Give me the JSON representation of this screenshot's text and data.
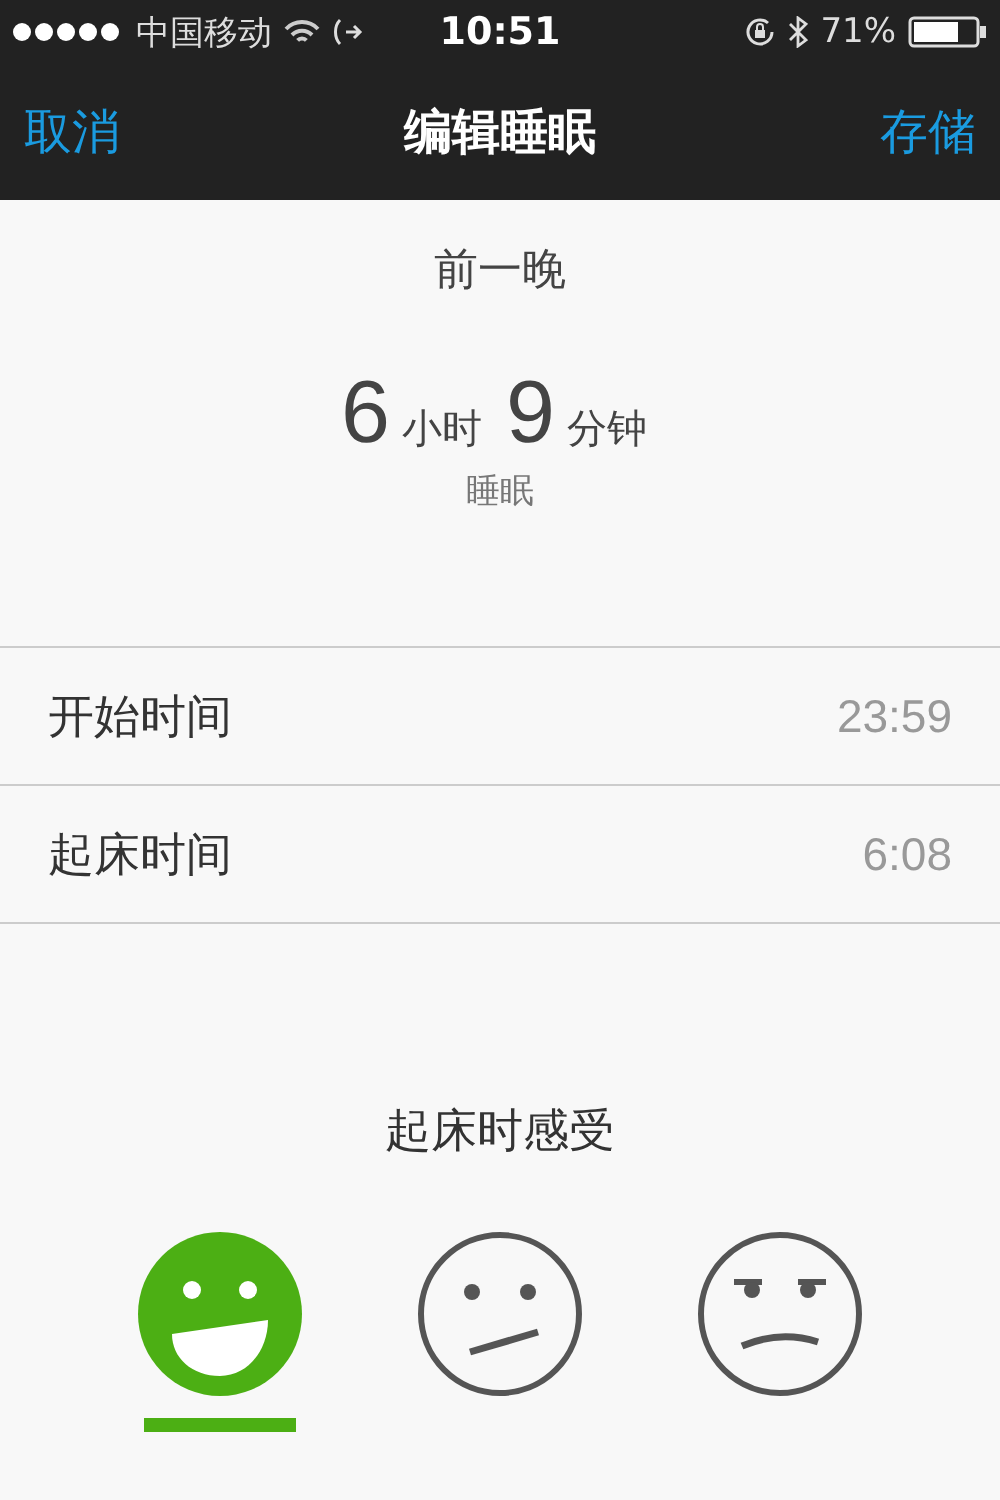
{
  "status_bar": {
    "carrier": "中国移动",
    "time": "10:51",
    "battery": "71%"
  },
  "nav": {
    "left": "取消",
    "title": "编辑睡眠",
    "right": "存储"
  },
  "summary": {
    "heading": "前一晚",
    "hours": "6",
    "hours_unit": "小时",
    "minutes": "9",
    "minutes_unit": "分钟",
    "caption": "睡眠"
  },
  "rows": [
    {
      "label": "开始时间",
      "value": "23:59"
    },
    {
      "label": "起床时间",
      "value": "6:08"
    }
  ],
  "mood": {
    "heading": "起床时感受",
    "options": [
      {
        "kind": "happy",
        "selected": true
      },
      {
        "kind": "neutral",
        "selected": false
      },
      {
        "kind": "grumpy",
        "selected": false
      }
    ]
  }
}
